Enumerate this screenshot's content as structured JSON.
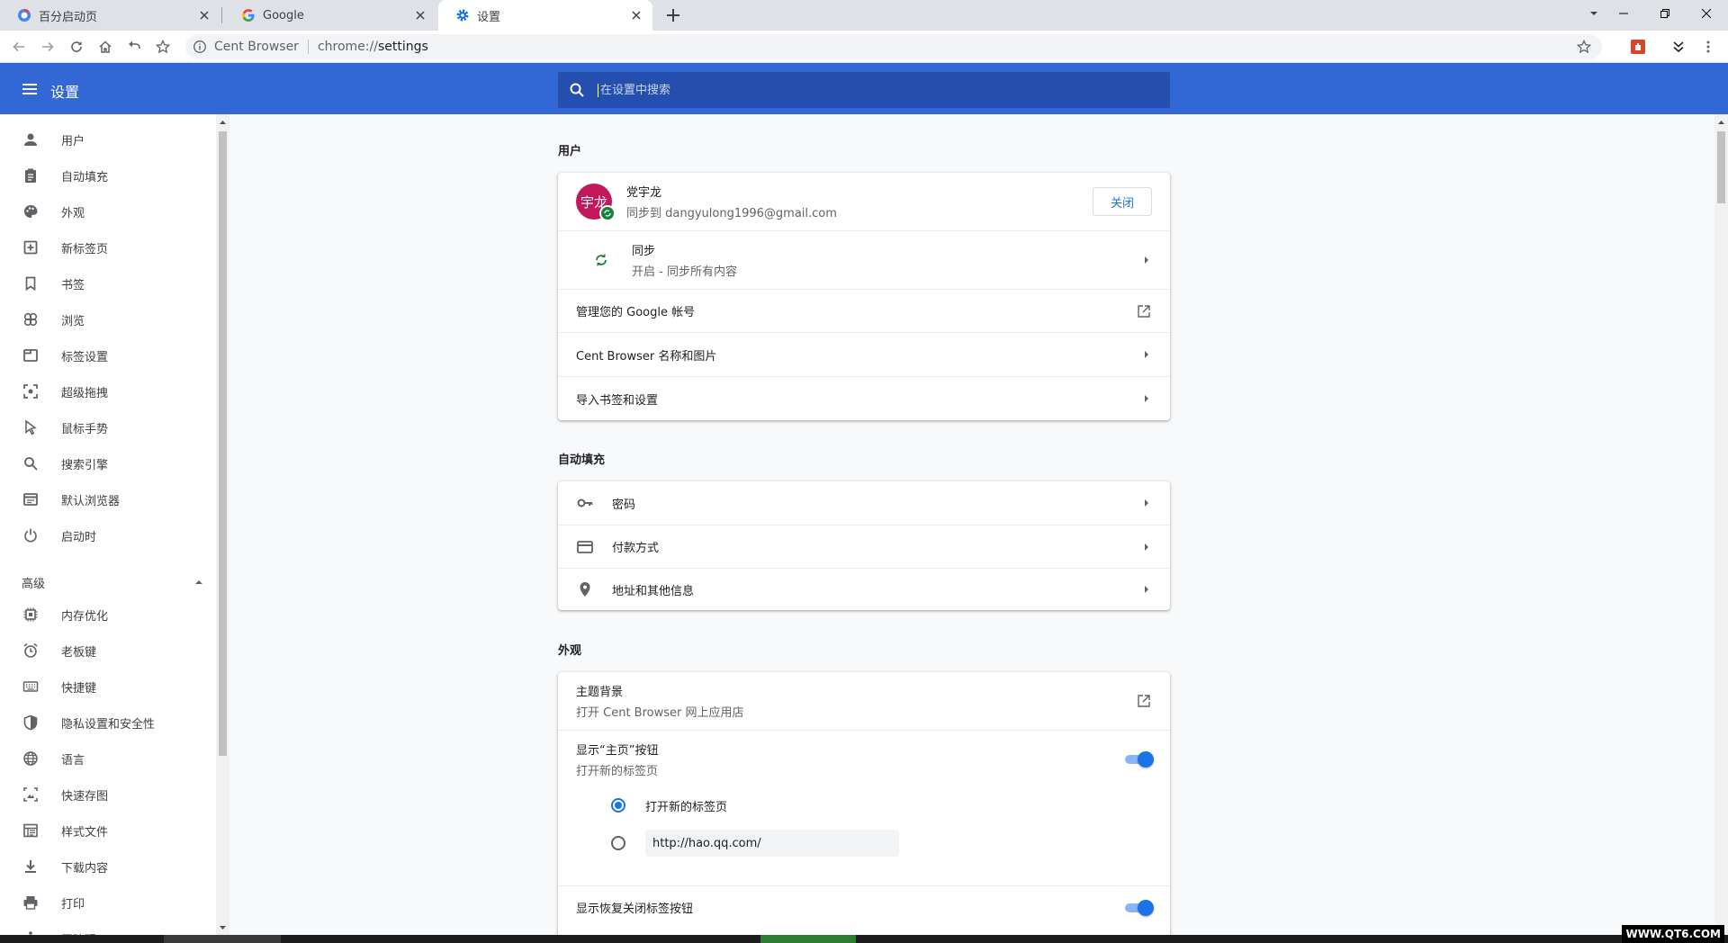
{
  "tabs": [
    {
      "title": "百分启动页",
      "active": false
    },
    {
      "title": "Google",
      "active": false
    },
    {
      "title": "设置",
      "active": true
    }
  ],
  "omnibox": {
    "site": "Cent Browser",
    "url_scheme": "chrome://",
    "url_path": "settings"
  },
  "header": {
    "title": "设置",
    "search_placeholder": "在设置中搜索"
  },
  "sidebar": {
    "items": [
      {
        "label": "用户",
        "icon": "person-icon"
      },
      {
        "label": "自动填充",
        "icon": "clipboard-icon"
      },
      {
        "label": "外观",
        "icon": "palette-icon"
      },
      {
        "label": "新标签页",
        "icon": "new-tab-icon"
      },
      {
        "label": "书签",
        "icon": "bookmark-icon"
      },
      {
        "label": "浏览",
        "icon": "browse-icon"
      },
      {
        "label": "标签设置",
        "icon": "tab-icon"
      },
      {
        "label": "超级拖拽",
        "icon": "drag-icon"
      },
      {
        "label": "鼠标手势",
        "icon": "cursor-icon"
      },
      {
        "label": "搜索引擎",
        "icon": "search-icon"
      },
      {
        "label": "默认浏览器",
        "icon": "browser-icon"
      },
      {
        "label": "启动时",
        "icon": "power-icon"
      }
    ],
    "advanced_label": "高级",
    "advanced_items": [
      {
        "label": "内存优化",
        "icon": "chip-icon"
      },
      {
        "label": "老板键",
        "icon": "alarm-icon"
      },
      {
        "label": "快捷键",
        "icon": "keyboard-icon"
      },
      {
        "label": "隐私设置和安全性",
        "icon": "shield-icon"
      },
      {
        "label": "语言",
        "icon": "globe-icon"
      },
      {
        "label": "快速存图",
        "icon": "image-icon"
      },
      {
        "label": "样式文件",
        "icon": "style-icon"
      },
      {
        "label": "下载内容",
        "icon": "download-icon"
      },
      {
        "label": "打印",
        "icon": "print-icon"
      },
      {
        "label": "无障碍",
        "icon": "accessibility-icon"
      }
    ]
  },
  "users": {
    "heading": "用户",
    "account_name": "党宇龙",
    "avatar_text": "宇龙",
    "sync_email": "同步到 dangyulong1996@gmail.com",
    "off_button": "关闭",
    "sync_title": "同步",
    "sync_subtitle": "开启 - 同步所有内容",
    "manage_google": "管理您的 Google 帐号",
    "name_picture": "Cent Browser 名称和图片",
    "import": "导入书签和设置"
  },
  "autofill": {
    "heading": "自动填充",
    "passwords": "密码",
    "payments": "付款方式",
    "addresses": "地址和其他信息"
  },
  "appearance": {
    "heading": "外观",
    "theme_title": "主题背景",
    "theme_subtitle": "打开 Cent Browser 网上应用店",
    "home_title": "显示“主页”按钮",
    "home_subtitle": "打开新的标签页",
    "home_on": true,
    "radio_ntp": "打开新的标签页",
    "radio_url_value": "http://hao.qq.com/",
    "restore_title": "显示恢复关闭标签按钮",
    "restore_on": true
  },
  "watermark": "WWW.QT6.COM",
  "colors": {
    "header": "#3367d6",
    "search_bg": "#254fae",
    "accent": "#1a73e8"
  }
}
